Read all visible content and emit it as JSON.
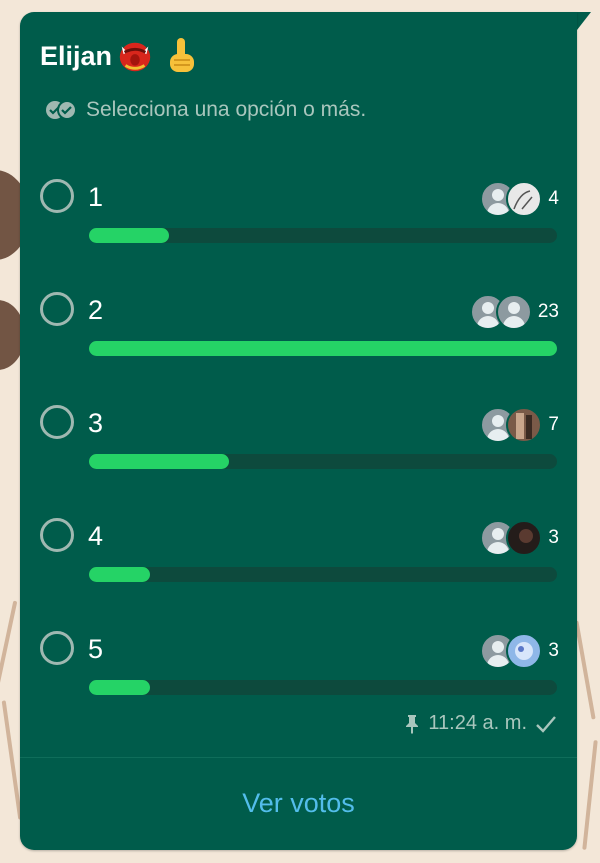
{
  "poll": {
    "title": "Elijan",
    "subtitle": "Selecciona una opción o más.",
    "options": [
      {
        "label": "1",
        "votes": "4",
        "fraction": 0.17
      },
      {
        "label": "2",
        "votes": "23",
        "fraction": 1.0
      },
      {
        "label": "3",
        "votes": "7",
        "fraction": 0.3
      },
      {
        "label": "4",
        "votes": "3",
        "fraction": 0.13
      },
      {
        "label": "5",
        "votes": "3",
        "fraction": 0.13
      }
    ],
    "time": "11:24 a. m.",
    "view_votes_label": "Ver votos"
  },
  "colors": {
    "bubble": "#005c4b",
    "bar_fill": "#25d366",
    "bar_track": "#0d4a3d",
    "link": "#53bdeb"
  },
  "icons": {
    "emoji_1": "red-mask-emoji-icon",
    "emoji_2": "pointing-up-emoji-icon",
    "multi_select": "double-check-icon",
    "pin": "pin-icon",
    "status": "check-icon"
  }
}
